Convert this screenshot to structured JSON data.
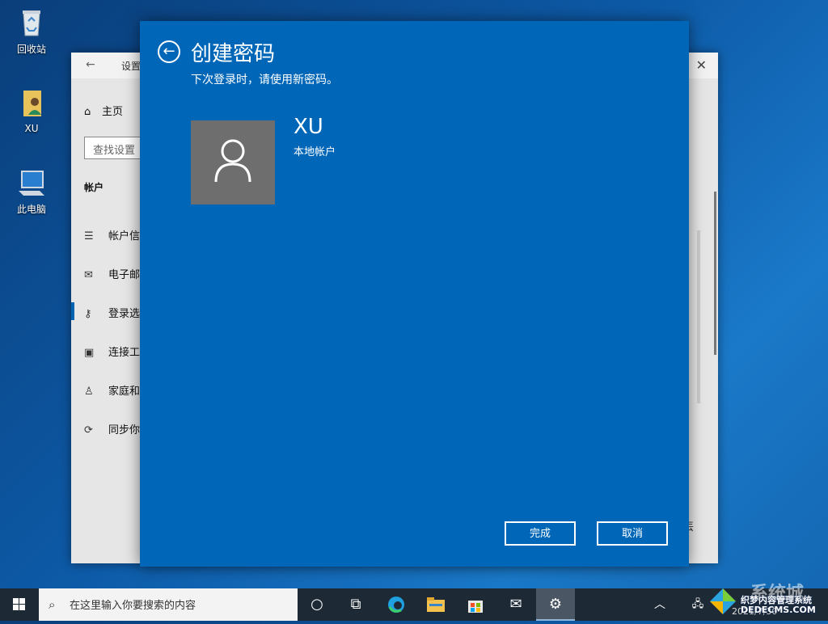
{
  "desktop": {
    "icons": [
      {
        "label": "回收站"
      },
      {
        "label": "XU"
      },
      {
        "label": "此电脑"
      }
    ]
  },
  "settings_window": {
    "title": "设置",
    "home_label": "主页",
    "search_placeholder": "查找设置",
    "section_label": "帐户",
    "items": [
      {
        "label": "帐户信"
      },
      {
        "label": "电子邮"
      },
      {
        "label": "登录选"
      },
      {
        "label": "连接工"
      },
      {
        "label": "家庭和"
      },
      {
        "label": "同步你"
      }
    ],
    "partial_text": "丟"
  },
  "dialog": {
    "title": "创建密码",
    "subtitle": "下次登录时，请使用新密码。",
    "user_name": "XU",
    "account_type": "本地帐户",
    "done_label": "完成",
    "cancel_label": "取消",
    "colors": {
      "background": "#0067b8",
      "avatar": "#6e6e6e"
    }
  },
  "taskbar": {
    "search_placeholder": "在这里输入你要搜索的内容",
    "clock_partial": "2021/7/30"
  },
  "watermark": {
    "top": "系统城",
    "middle": "织梦内容管理系统",
    "bottom": "DEDECMS.COM"
  }
}
